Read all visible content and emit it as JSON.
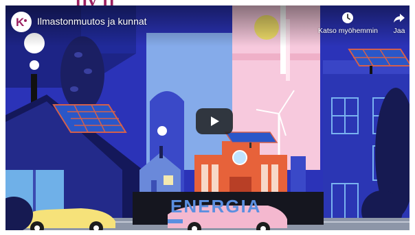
{
  "player": {
    "title": "Ilmastonmuutos ja kunnat",
    "channel_logo_letter": "K",
    "actions": {
      "watch_later_label": "Katso myöhemmin",
      "share_label": "Jaa"
    }
  },
  "scene": {
    "banner_text": "ENERGIA"
  },
  "colors": {
    "brand": "#9b2060",
    "sky": "#2b33b8",
    "banner": "#5b8fe0",
    "car_pink": "#f4b8cf",
    "car_yellow": "#f6e27a"
  }
}
